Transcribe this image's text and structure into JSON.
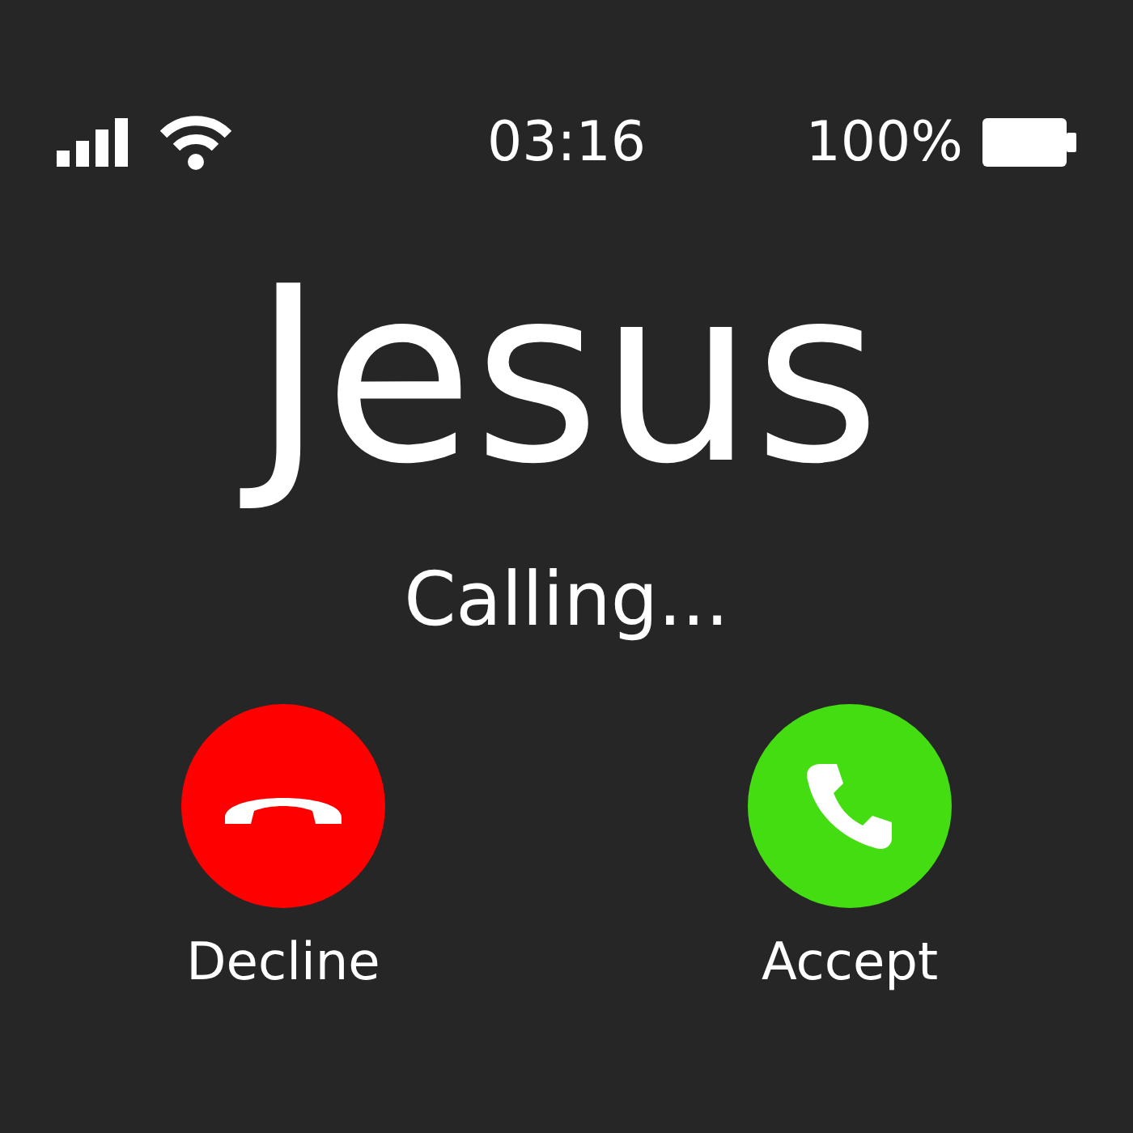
{
  "status_bar": {
    "time": "03:16",
    "battery_percent": "100%"
  },
  "caller": {
    "name": "Jesus",
    "status": "Calling..."
  },
  "actions": [
    {
      "kind": "decline",
      "label": "Decline",
      "color": "#ff0000"
    },
    {
      "kind": "accept",
      "label": "Accept",
      "color": "#44dd11"
    }
  ]
}
